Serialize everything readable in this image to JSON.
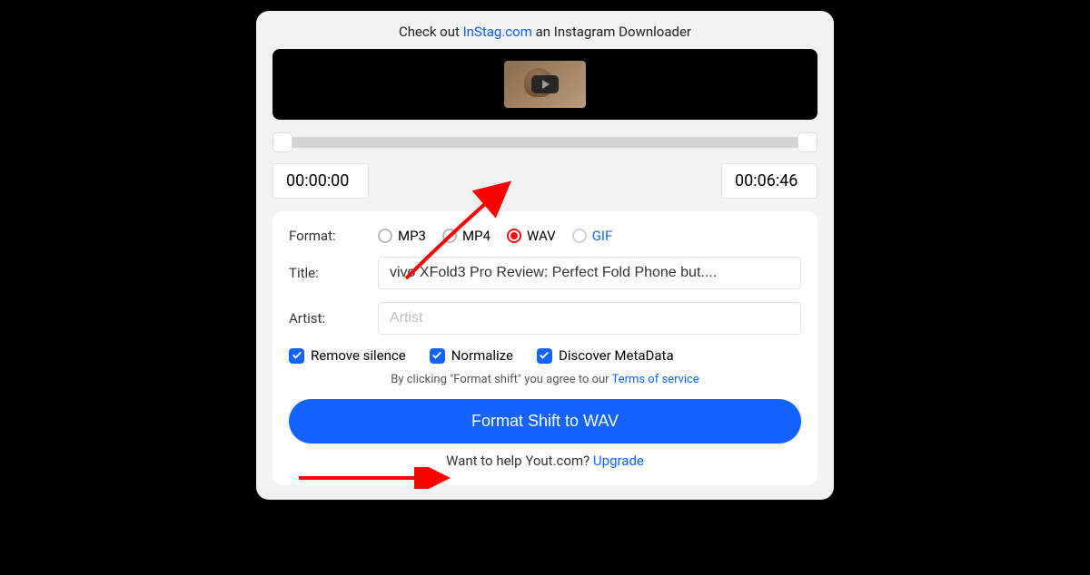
{
  "promo": {
    "prefix": "Check out ",
    "link": "InStag.com",
    "suffix": " an Instagram Downloader"
  },
  "time": {
    "start": "00:00:00",
    "end": "00:06:46"
  },
  "format": {
    "label": "Format:",
    "mp3": "MP3",
    "mp4": "MP4",
    "wav": "WAV",
    "gif": "GIF",
    "selected": "WAV"
  },
  "title": {
    "label": "Title:",
    "value": "vivo XFold3 Pro Review: Perfect Fold Phone but...."
  },
  "artist": {
    "label": "Artist:",
    "value": "",
    "placeholder": "Artist"
  },
  "checks": {
    "remove_silence": "Remove silence",
    "normalize": "Normalize",
    "discover_meta": "Discover MetaData"
  },
  "terms": {
    "prefix": "By clicking \"Format shift\" you agree to our ",
    "link": "Terms of service"
  },
  "action_label": "Format Shift to WAV",
  "upgrade": {
    "prefix": "Want to help Yout.com? ",
    "link": "Upgrade"
  }
}
